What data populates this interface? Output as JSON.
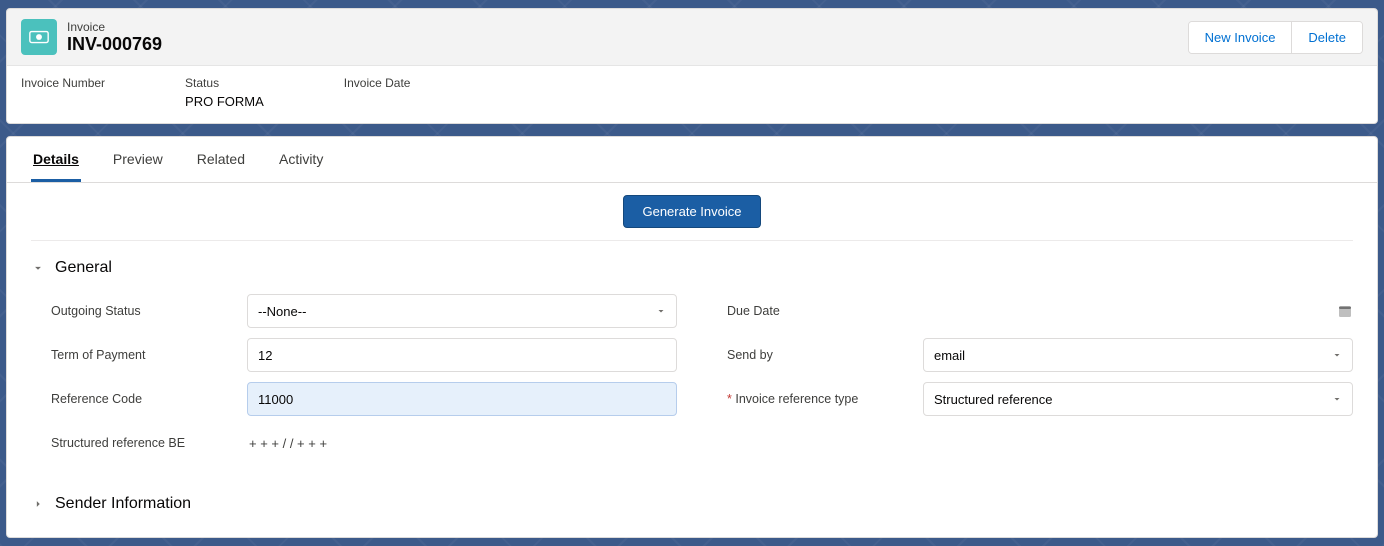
{
  "header": {
    "object_label": "Invoice",
    "title": "INV-000769",
    "buttons": {
      "new": "New Invoice",
      "delete": "Delete"
    },
    "fields": {
      "invoice_number": {
        "label": "Invoice Number",
        "value": ""
      },
      "status": {
        "label": "Status",
        "value": "PRO FORMA"
      },
      "invoice_date": {
        "label": "Invoice Date",
        "value": ""
      }
    }
  },
  "tabs": {
    "details": "Details",
    "preview": "Preview",
    "related": "Related",
    "activity": "Activity"
  },
  "actions": {
    "generate": "Generate Invoice"
  },
  "sections": {
    "general": {
      "title": "General",
      "fields": {
        "outgoing_status": {
          "label": "Outgoing Status",
          "value": "--None--"
        },
        "due_date": {
          "label": "Due Date",
          "value": ""
        },
        "term_of_payment": {
          "label": "Term of Payment",
          "value": "12"
        },
        "send_by": {
          "label": "Send by",
          "value": "email"
        },
        "reference_code": {
          "label": "Reference Code",
          "value": "11000"
        },
        "invoice_ref_type": {
          "label": "Invoice reference type",
          "value": "Structured reference"
        },
        "structured_ref_be": {
          "label": "Structured reference BE",
          "value": "+ + + / / + + +"
        }
      }
    },
    "sender": {
      "title": "Sender Information"
    }
  }
}
